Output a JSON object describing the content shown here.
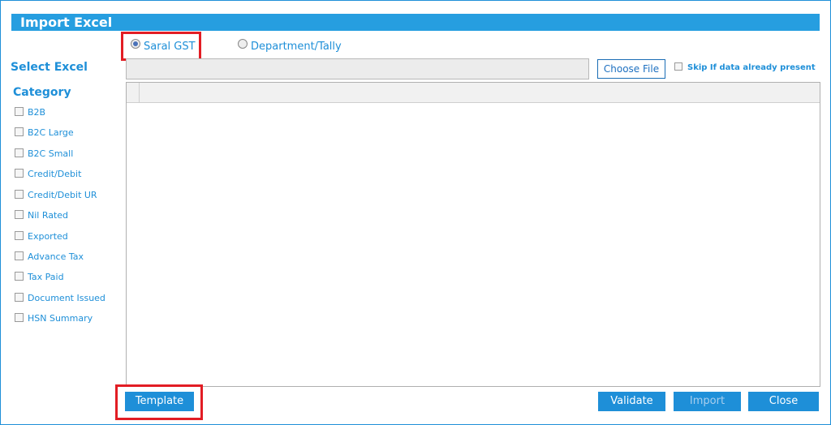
{
  "window": {
    "title": "Import Excel"
  },
  "source_options": [
    {
      "label": "Saral GST",
      "selected": true
    },
    {
      "label": "Department/Tally",
      "selected": false
    }
  ],
  "labels": {
    "select_excel": "Select Excel",
    "category": "Category"
  },
  "file": {
    "choose_label": "Choose File",
    "value": ""
  },
  "skip_option": {
    "label": "Skip If data already present",
    "checked": false
  },
  "categories": [
    {
      "label": "B2B",
      "checked": false
    },
    {
      "label": "B2C Large",
      "checked": false
    },
    {
      "label": "B2C Small",
      "checked": false
    },
    {
      "label": "Credit/Debit",
      "checked": false
    },
    {
      "label": "Credit/Debit UR",
      "checked": false
    },
    {
      "label": "Nil Rated",
      "checked": false
    },
    {
      "label": "Exported",
      "checked": false
    },
    {
      "label": "Advance Tax",
      "checked": false
    },
    {
      "label": "Tax Paid",
      "checked": false
    },
    {
      "label": "Document Issued",
      "checked": false
    },
    {
      "label": "HSN Summary",
      "checked": false
    }
  ],
  "buttons": {
    "template": "Template",
    "validate": "Validate",
    "import": "Import",
    "close": "Close"
  },
  "colors": {
    "accent": "#1e8fd8",
    "highlight": "#e21d24"
  }
}
